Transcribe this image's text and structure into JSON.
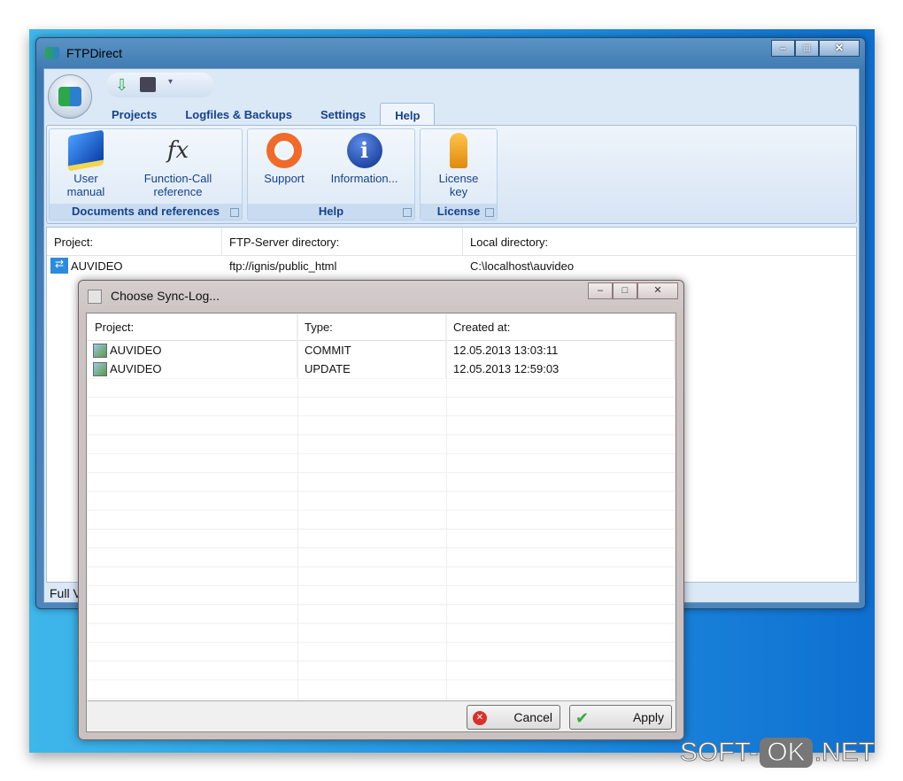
{
  "window": {
    "title": "FTPDirect",
    "buttons": [
      "minimize",
      "maximize",
      "close"
    ]
  },
  "ribbon": {
    "tabs": [
      {
        "label": "Projects"
      },
      {
        "label": "Logfiles & Backups"
      },
      {
        "label": "Settings"
      },
      {
        "label": "Help",
        "active": true
      }
    ],
    "groups": [
      {
        "label": "Documents and references",
        "buttons": [
          {
            "line1": "User",
            "line2": "manual",
            "icon": "book-icon"
          },
          {
            "line1": "Function-Call",
            "line2": "reference",
            "icon": "function-icon"
          }
        ]
      },
      {
        "label": "Help",
        "buttons": [
          {
            "line1": "Support",
            "icon": "lifebuoy-icon"
          },
          {
            "line1": "Information...",
            "icon": "info-icon"
          }
        ]
      },
      {
        "label": "License",
        "buttons": [
          {
            "line1": "License",
            "line2": "key",
            "icon": "key-icon"
          }
        ]
      }
    ]
  },
  "projects": {
    "headers": [
      "Project:",
      "FTP-Server directory:",
      "Local directory:"
    ],
    "rows": [
      {
        "project": "AUVIDEO",
        "ftp": "ftp://ignis/public_html",
        "local": "C:\\localhost\\auvideo"
      }
    ]
  },
  "status": {
    "text": "Full V"
  },
  "dialog": {
    "title": "Choose Sync-Log...",
    "headers": [
      "Project:",
      "Type:",
      "Created at:"
    ],
    "rows": [
      {
        "project": "AUVIDEO",
        "type": "COMMIT",
        "created": "12.05.2013 13:03:11"
      },
      {
        "project": "AUVIDEO",
        "type": "UPDATE",
        "created": "12.05.2013 12:59:03"
      }
    ],
    "cancel": "Cancel",
    "apply": "Apply"
  },
  "watermark": {
    "a": "SOFT-",
    "b": "OK",
    ".c": ".NET",
    "c": ".NET"
  }
}
